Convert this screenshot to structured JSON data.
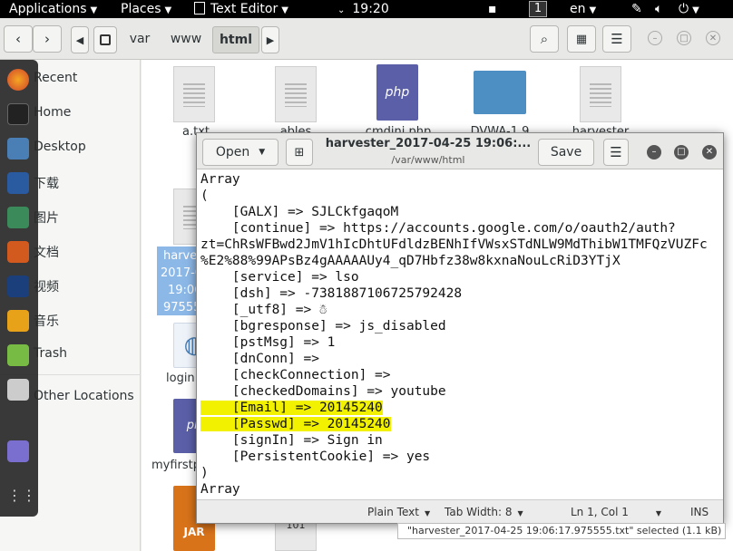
{
  "topbar": {
    "applications": "Applications",
    "places": "Places",
    "active_app": "Text Editor",
    "clock": "19:20",
    "workspace": "1",
    "language": "en"
  },
  "file_manager": {
    "path": [
      "var",
      "www",
      "html"
    ],
    "sidebar": [
      "Recent",
      "Home",
      "Desktop",
      "下载",
      "图片",
      "文档",
      "视频",
      "音乐",
      "Trash",
      "Other Locations"
    ],
    "files": [
      "a.txt",
      "ables",
      "cmdini.php",
      "DVWA-1.9",
      "harvester",
      "harve",
      "2017-0",
      "19:06",
      "97555",
      "login.",
      "myfirstp"
    ],
    "selection_status": "\"harvester_2017-04-25 19:06:17.975555.txt\" selected  (1.1 kB)"
  },
  "editor": {
    "open_label": "Open",
    "save_label": "Save",
    "title": "harvester_2017-04-25 19:06:...",
    "subtitle": "/var/www/html",
    "lines": [
      "Array",
      "(",
      "    [GALX] => SJLCkfgaqoM",
      "    [continue] => https://accounts.google.com/o/oauth2/auth?",
      "zt=ChRsWFBwd2JmV1hIcDhtUFdldzBENhIfVWsxSTdNLW9MdThibW1TMFQzVUZFc",
      "%E2%88%99APsBz4gAAAAAUy4_qD7Hbfz38w8kxnaNouLcRiD3YTjX",
      "    [service] => lso",
      "    [dsh] => -7381887106725792428",
      "    [_utf8] => ☃",
      "    [bgresponse] => js_disabled",
      "    [pstMsg] => 1",
      "    [dnConn] =>",
      "    [checkConnection] =>",
      "    [checkedDomains] => youtube",
      "    [Email] => 20145240",
      "    [Passwd] => 20145240",
      "    [signIn] => Sign in",
      "    [PersistentCookie] => yes",
      ")",
      "Array",
      "("
    ],
    "status": {
      "syntax": "Plain Text",
      "tab_width": "Tab Width: 8",
      "position": "Ln 1, Col 1",
      "mode": "INS"
    }
  }
}
